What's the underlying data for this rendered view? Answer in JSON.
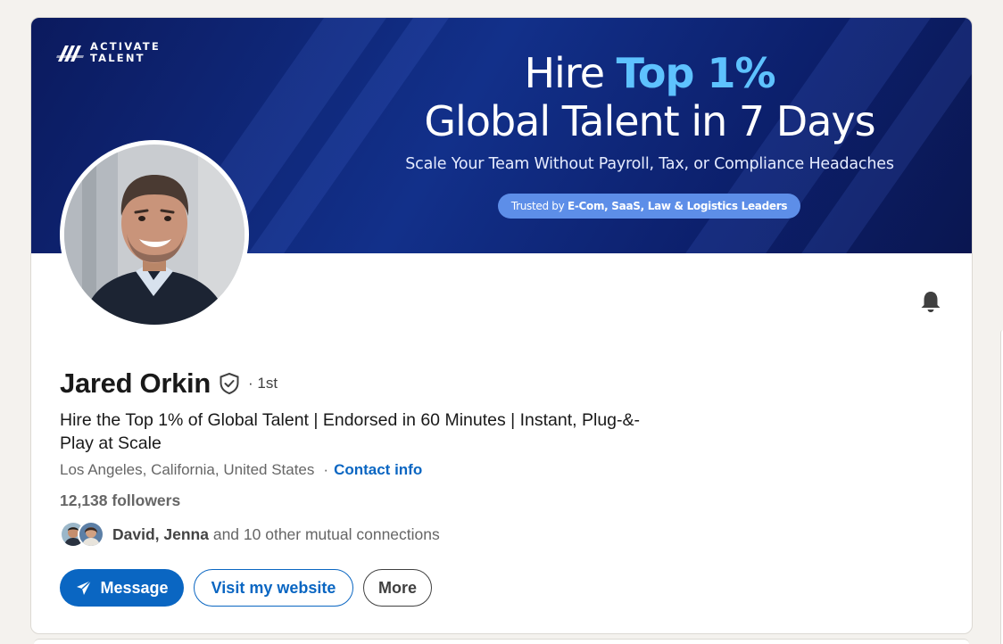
{
  "banner": {
    "logo_line1": "ACTIVATE",
    "logo_line2": "TALENT",
    "headline_line1_prefix": "Hire ",
    "headline_line1_accent": "Top 1%",
    "headline_line2": "Global Talent in 7 Days",
    "subheadline": "Scale Your Team Without Payroll, Tax, or Compliance Headaches",
    "pill_prefix": "Trusted by ",
    "pill_bold": "E-Com, SaaS, Law & Logistics Leaders",
    "colors": {
      "background": "#12308a",
      "accent": "#5ec2ff",
      "pill": "#5d8ee8"
    }
  },
  "profile": {
    "name": "Jared Orkin",
    "degree": "· 1st",
    "headline": "Hire the Top 1% of Global Talent | Endorsed in 60 Minutes | Instant, Plug-&-Play at Scale",
    "location": "Los Angeles, California, United States",
    "location_separator": "·",
    "contact_info_label": "Contact info",
    "followers": "12,138 followers",
    "mutual_names": "David, Jenna",
    "mutual_rest": " and 10 other mutual connections"
  },
  "actions": {
    "message_label": "Message",
    "website_label": "Visit my website",
    "more_label": "More"
  },
  "icons": {
    "bell": "bell-icon",
    "verified": "verified-shield-icon",
    "send": "paper-plane-icon"
  },
  "colors": {
    "link_blue": "#0a66c2",
    "page_bg": "#f4f2ee",
    "card_bg": "#ffffff"
  }
}
